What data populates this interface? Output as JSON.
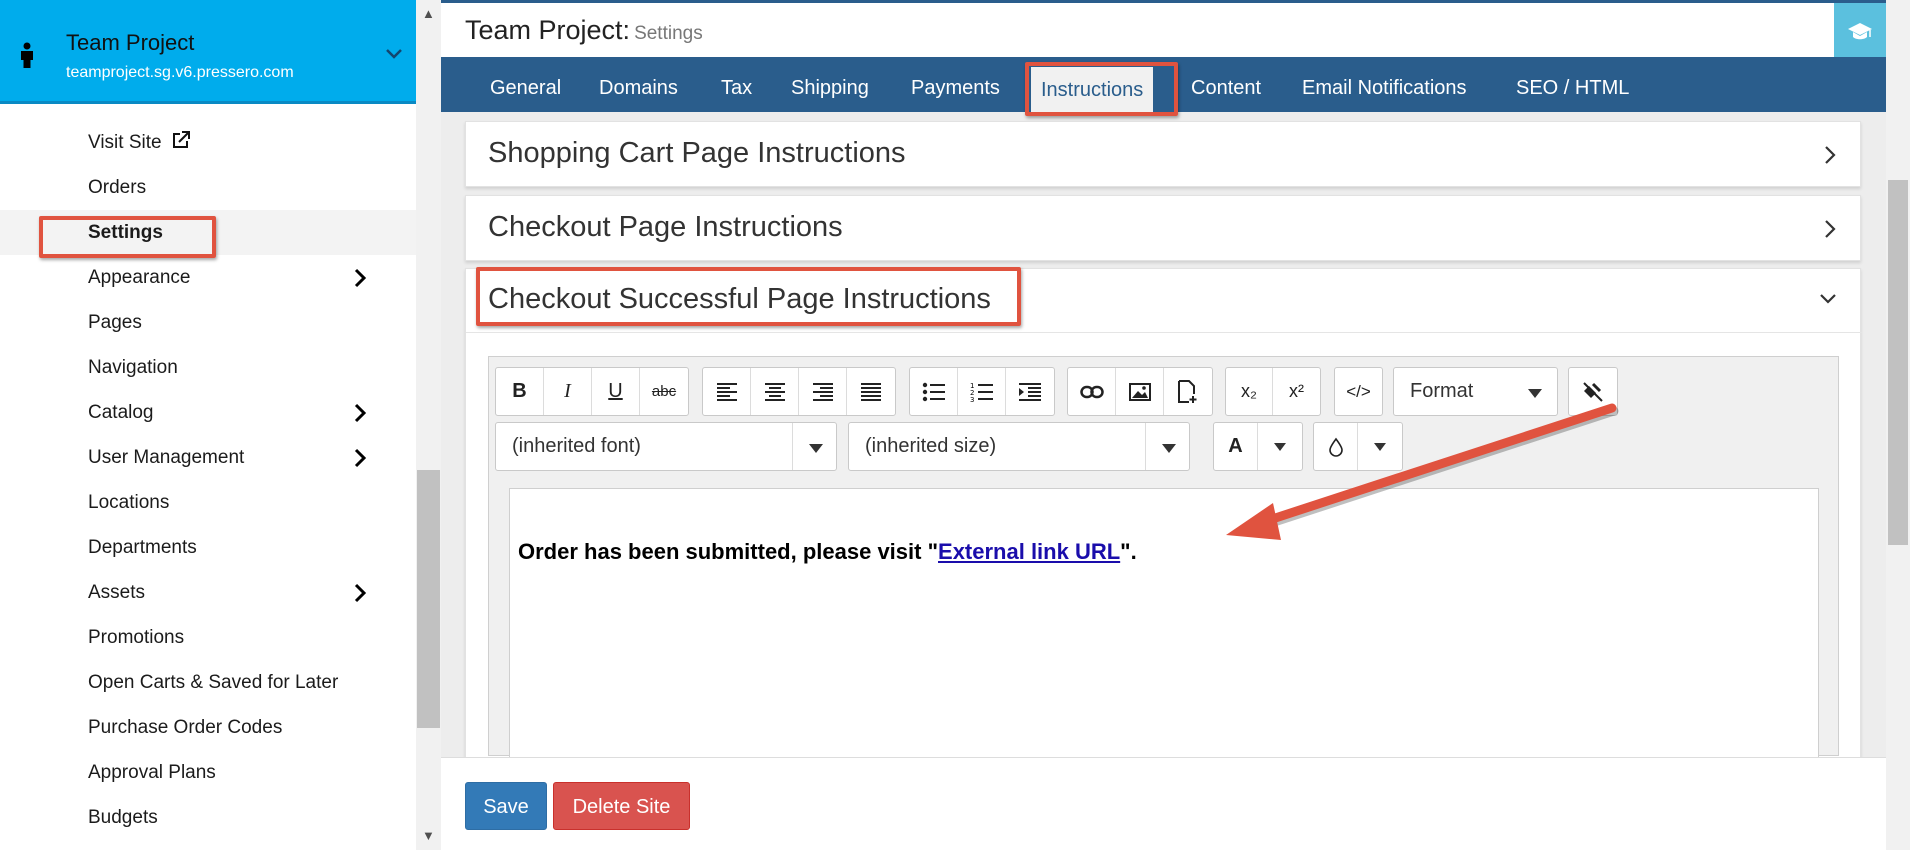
{
  "site": {
    "title": "Team Project",
    "domain": "teamproject.sg.v6.pressero.com"
  },
  "sidebar": {
    "items": [
      {
        "label": "Visit Site",
        "icon": "external-link-icon"
      },
      {
        "label": "Orders"
      },
      {
        "label": "Settings",
        "active": true
      },
      {
        "label": "Appearance",
        "has_submenu": true
      },
      {
        "label": "Pages"
      },
      {
        "label": "Navigation"
      },
      {
        "label": "Catalog",
        "has_submenu": true
      },
      {
        "label": "User Management",
        "has_submenu": true
      },
      {
        "label": "Locations"
      },
      {
        "label": "Departments"
      },
      {
        "label": "Assets",
        "has_submenu": true
      },
      {
        "label": "Promotions"
      },
      {
        "label": "Open Carts & Saved for Later"
      },
      {
        "label": "Purchase Order Codes"
      },
      {
        "label": "Approval Plans"
      },
      {
        "label": "Budgets"
      }
    ]
  },
  "header": {
    "title": "Team Project:",
    "subtitle": "Settings",
    "help_icon": "graduation-cap-icon"
  },
  "tabs": [
    {
      "label": "General"
    },
    {
      "label": "Domains"
    },
    {
      "label": "Tax"
    },
    {
      "label": "Shipping"
    },
    {
      "label": "Payments"
    },
    {
      "label": "Instructions",
      "active": true
    },
    {
      "label": "Content"
    },
    {
      "label": "Email Notifications"
    },
    {
      "label": "SEO / HTML"
    }
  ],
  "panels": [
    {
      "title": "Shopping Cart Page Instructions",
      "expanded": false
    },
    {
      "title": "Checkout Page Instructions",
      "expanded": false
    },
    {
      "title": "Checkout Successful Page Instructions",
      "expanded": true
    }
  ],
  "editor": {
    "toolbar": {
      "bold": "B",
      "italic": "I",
      "underline": "U",
      "strike": "abc",
      "subscript": "x₂",
      "superscript": "x²",
      "source": "</>",
      "format_label": "Format",
      "font_value": "(inherited font)",
      "size_value": "(inherited size)",
      "text_color": "A"
    },
    "content": {
      "text_before": "Order has been submitted, please visit \"",
      "link_text": "External link URL",
      "text_after": "\"."
    }
  },
  "footer": {
    "save_label": "Save",
    "delete_label": "Delete Site"
  },
  "colors": {
    "brand": "#00acec",
    "tabbar": "#2a5d8c",
    "save": "#337ab7",
    "delete": "#d9534f",
    "annotation": "#e0533f"
  }
}
